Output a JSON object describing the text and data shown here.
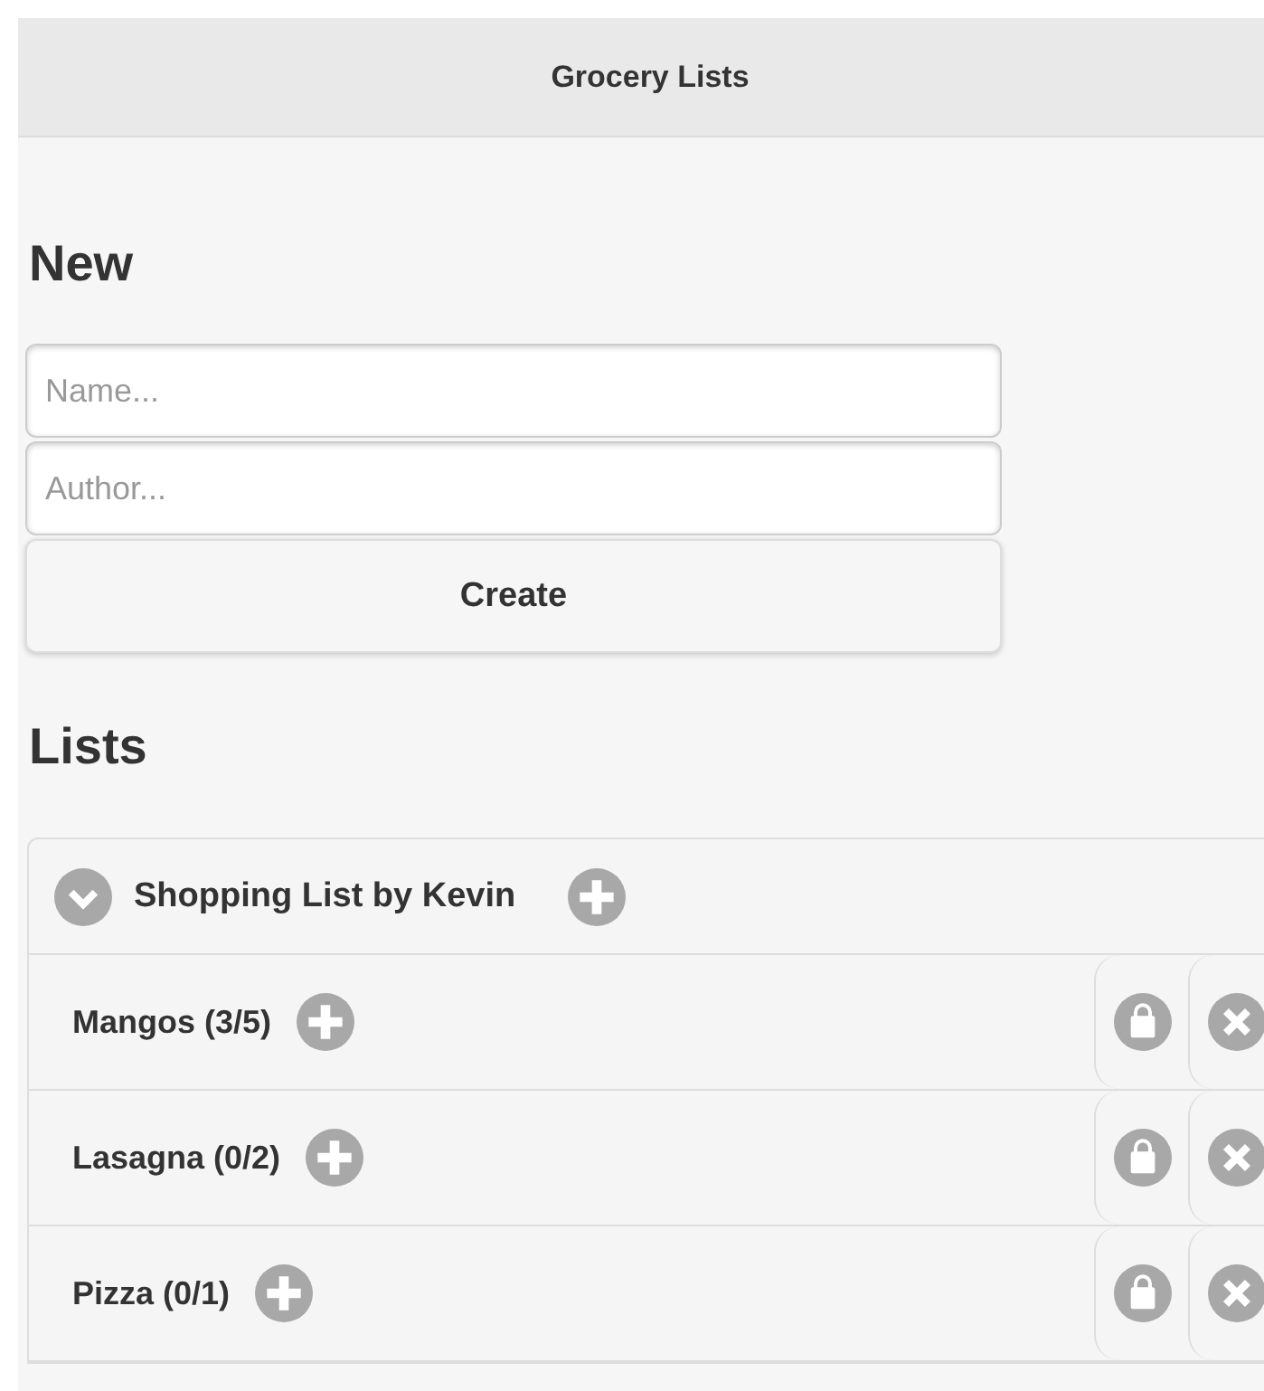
{
  "header": {
    "title": "Grocery Lists"
  },
  "new_section": {
    "heading": "New",
    "name_field": {
      "placeholder": "Name..."
    },
    "author_field": {
      "placeholder": "Author..."
    },
    "create_button": "Create"
  },
  "lists_section": {
    "heading": "Lists",
    "lists": [
      {
        "title": "Shopping List by Kevin",
        "expanded": true,
        "items": [
          {
            "label": "Mangos (3/5)"
          },
          {
            "label": "Lasagna (0/2)"
          },
          {
            "label": "Pizza (0/1)"
          }
        ]
      }
    ]
  }
}
